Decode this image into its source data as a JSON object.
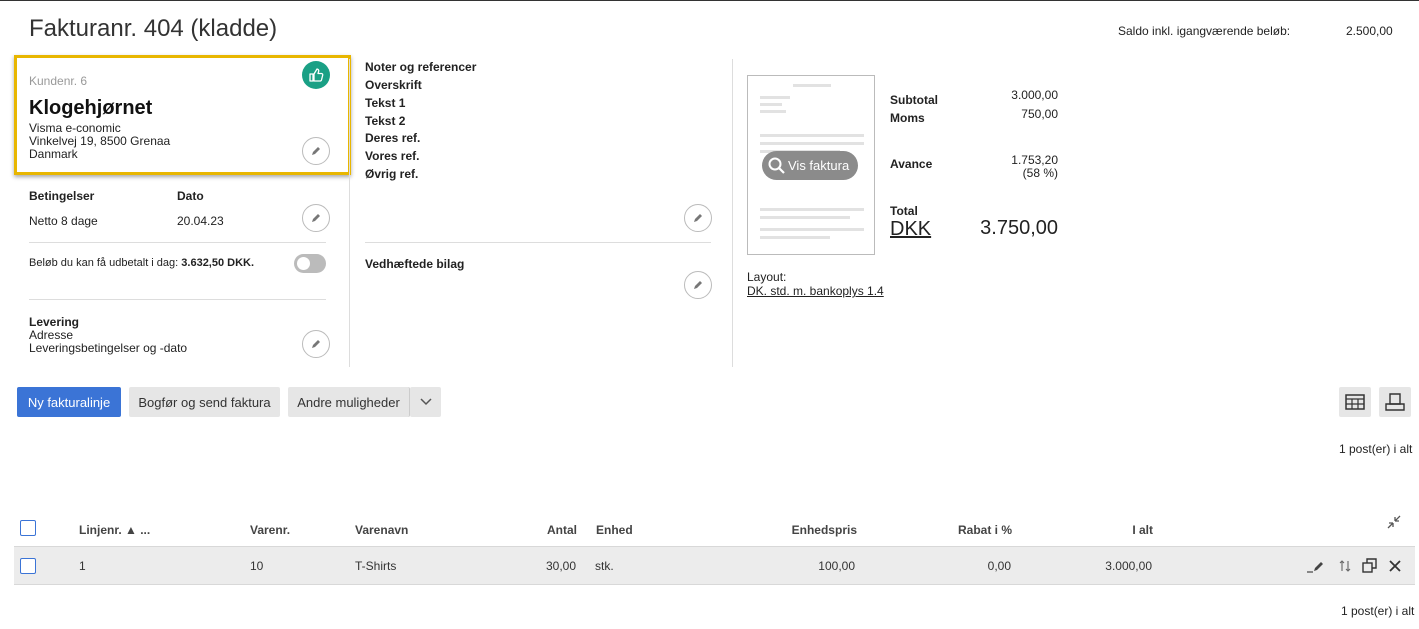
{
  "header": {
    "title": "Fakturanr. 404 (kladde)",
    "saldo_label": "Saldo inkl. igangværende beløb:",
    "saldo_value": "2.500,00"
  },
  "customer": {
    "number": "Kundenr. 6",
    "name": "Klogehjørnet",
    "address_lines": [
      "Visma e-conomic",
      "Vinkelvej 19, 8500 Grenaa",
      "Danmark"
    ]
  },
  "terms": {
    "betingelser_label": "Betingelser",
    "betingelser_value": "Netto 8 dage",
    "dato_label": "Dato",
    "dato_value": "20.04.23",
    "payout_text": "Beløb du kan få udbetalt i dag: ",
    "payout_amount": "3.632,50 DKK."
  },
  "delivery": {
    "title": "Levering",
    "line1": "Adresse",
    "line2": "Leveringsbetingelser og -dato"
  },
  "notes": {
    "title": "Noter og referencer",
    "items": [
      "Overskrift",
      "Tekst 1",
      "Tekst 2",
      "Deres ref.",
      "Vores ref.",
      "Øvrig ref."
    ]
  },
  "attachments": {
    "title": "Vedhæftede bilag"
  },
  "preview": {
    "button_label": "Vis faktura",
    "layout_label": "Layout:",
    "layout_link": "DK. std. m. bankoplys 1.4"
  },
  "totals": {
    "subtotal_label": "Subtotal",
    "subtotal_value": "3.000,00",
    "moms_label": "Moms",
    "moms_value": "750,00",
    "avance_label": "Avance",
    "avance_value": "1.753,20",
    "avance_pct": "(58 %)",
    "total_label": "Total",
    "currency": "DKK",
    "total_value": "3.750,00"
  },
  "toolbar": {
    "new_line": "Ny fakturalinje",
    "post_send": "Bogfør og send faktura",
    "other": "Andre muligheder"
  },
  "table": {
    "count_top": "1 post(er) i alt",
    "count_bottom": "1 post(er) i alt",
    "headers": {
      "linjenr": "Linjenr. ▲ ...",
      "varenr": "Varenr.",
      "varenavn": "Varenavn",
      "antal": "Antal",
      "enhed": "Enhed",
      "enhedspris": "Enhedspris",
      "rabat": "Rabat i %",
      "ialt": "I alt"
    },
    "rows": [
      {
        "linjenr": "1",
        "varenr": "10",
        "varenavn": "T-Shirts",
        "antal": "30,00",
        "enhed": "stk.",
        "enhedspris": "100,00",
        "rabat": "0,00",
        "ialt": "3.000,00"
      }
    ]
  }
}
